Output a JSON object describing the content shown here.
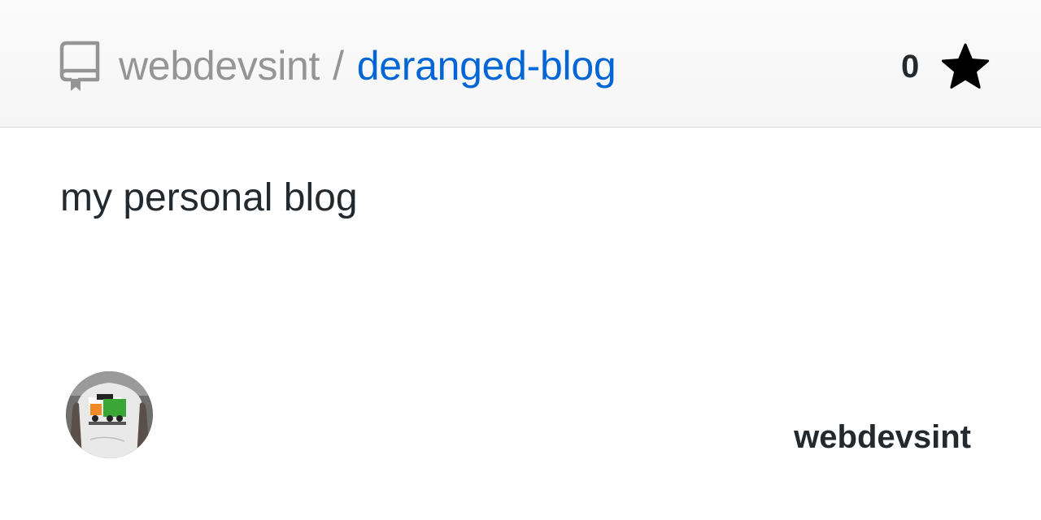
{
  "header": {
    "repo_icon": "repo-icon",
    "owner": "webdevsint",
    "separator": "/",
    "repo_name": "deranged-blog",
    "star_count": "0",
    "star_icon": "star-icon"
  },
  "description": "my personal blog",
  "footer": {
    "avatar_icon": "user-avatar-photo",
    "username": "webdevsint"
  },
  "colors": {
    "owner_text": "#959595",
    "repo_link": "#0366d6",
    "body_text": "#24292e",
    "header_bg": "#f5f5f5"
  }
}
